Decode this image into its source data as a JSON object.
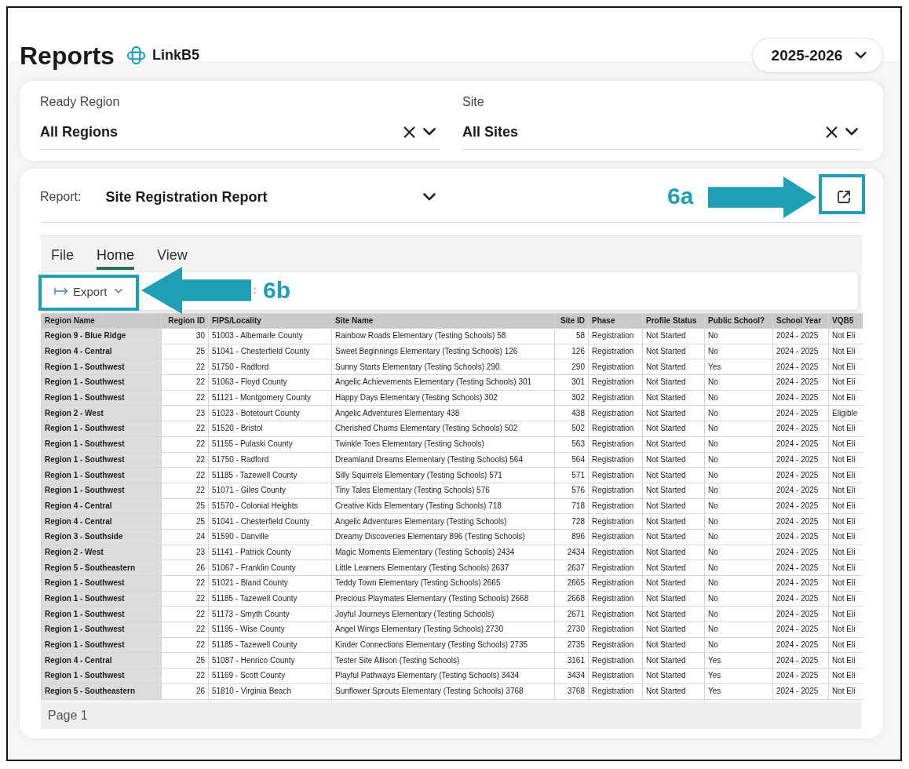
{
  "header": {
    "title": "Reports",
    "brand": "LinkB5",
    "year_select": {
      "value": "2025-2026"
    }
  },
  "filters": [
    {
      "label": "Ready Region",
      "value": "All Regions"
    },
    {
      "label": "Site",
      "value": "All Sites"
    }
  ],
  "report": {
    "label": "Report:",
    "value": "Site Registration Report",
    "annotation": {
      "label": "6a"
    }
  },
  "viewer": {
    "tabs": [
      {
        "label": "File",
        "selected": false
      },
      {
        "label": "Home",
        "selected": true
      },
      {
        "label": "View",
        "selected": false
      }
    ],
    "toolbar": {
      "export_button": {
        "label": "Export"
      },
      "annotation": {
        "label": "6b"
      }
    },
    "table": {
      "columns": [
        "Region Name",
        "Region ID",
        "FIPS/Locality",
        "Site Name",
        "Site ID",
        "Phase",
        "Profile Status",
        "Public School?",
        "School Year",
        "VQB5"
      ],
      "rows": [
        [
          "Region 9 - Blue Ridge",
          "30",
          "51003 - Albemarle County",
          "Rainbow Roads Elementary (Testing Schools) 58",
          "58",
          "Registration",
          "Not Started",
          "No",
          "2024 - 2025",
          "Not Eli"
        ],
        [
          "Region 4 - Central",
          "25",
          "51041 - Chesterfield County",
          "Sweet Beginnings Elementary (Testing Schools) 126",
          "126",
          "Registration",
          "Not Started",
          "No",
          "2024 - 2025",
          "Not Eli"
        ],
        [
          "Region 1 - Southwest",
          "22",
          "51750 - Radford",
          "Sunny Starts Elementary (Testing Schools) 290",
          "290",
          "Registration",
          "Not Started",
          "Yes",
          "2024 - 2025",
          "Not Eli"
        ],
        [
          "Region 1 - Southwest",
          "22",
          "51063 - Floyd County",
          "Angelic Achievements Elementary (Testing Schools) 301",
          "301",
          "Registration",
          "Not Started",
          "No",
          "2024 - 2025",
          "Not Eli"
        ],
        [
          "Region 1 - Southwest",
          "22",
          "51121 - Montgomery County",
          "Happy Days Elementary (Testing Schools) 302",
          "302",
          "Registration",
          "Not Started",
          "No",
          "2024 - 2025",
          "Not Eli"
        ],
        [
          "Region 2 - West",
          "23",
          "51023 - Botetourt County",
          "Angelic Adventures Elementary 438",
          "438",
          "Registration",
          "Not Started",
          "No",
          "2024 - 2025",
          "Eligible"
        ],
        [
          "Region 1 - Southwest",
          "22",
          "51520 - Bristol",
          "Cherished Chums Elementary (Testing Schools) 502",
          "502",
          "Registration",
          "Not Started",
          "No",
          "2024 - 2025",
          "Not Eli"
        ],
        [
          "Region 1 - Southwest",
          "22",
          "51155 - Pulaski County",
          "Twinkle Toes Elementary (Testing Schools)",
          "563",
          "Registration",
          "Not Started",
          "No",
          "2024 - 2025",
          "Not Eli"
        ],
        [
          "Region 1 - Southwest",
          "22",
          "51750 - Radford",
          "Dreamland Dreams Elementary (Testing Schools) 564",
          "564",
          "Registration",
          "Not Started",
          "No",
          "2024 - 2025",
          "Not Eli"
        ],
        [
          "Region 1 - Southwest",
          "22",
          "51185 - Tazewell County",
          "Silly Squirrels Elementary (Testing Schools) 571",
          "571",
          "Registration",
          "Not Started",
          "No",
          "2024 - 2025",
          "Not Eli"
        ],
        [
          "Region 1 - Southwest",
          "22",
          "51071 - Giles County",
          "Tiny Tales Elementary (Testing Schools) 576",
          "576",
          "Registration",
          "Not Started",
          "No",
          "2024 - 2025",
          "Not Eli"
        ],
        [
          "Region 4 - Central",
          "25",
          "51570 - Colonial Heights",
          "Creative Kids Elementary (Testing Schools) 718",
          "718",
          "Registration",
          "Not Started",
          "No",
          "2024 - 2025",
          "Not Eli"
        ],
        [
          "Region 4 - Central",
          "25",
          "51041 - Chesterfield County",
          "Angelic Adventures Elementary (Testing Schools)",
          "728",
          "Registration",
          "Not Started",
          "No",
          "2024 - 2025",
          "Not Eli"
        ],
        [
          "Region 3 - Southside",
          "24",
          "51590 - Danville",
          "Dreamy Discoveries Elementary 896 (Testing Schools)",
          "896",
          "Registration",
          "Not Started",
          "No",
          "2024 - 2025",
          "Not Eli"
        ],
        [
          "Region 2 - West",
          "23",
          "51141 - Patrick County",
          "Magic Moments Elementary (Testing Schools) 2434",
          "2434",
          "Registration",
          "Not Started",
          "No",
          "2024 - 2025",
          "Not Eli"
        ],
        [
          "Region 5 - Southeastern",
          "26",
          "51067 - Franklin County",
          "Little Learners Elementary (Testing Schools) 2637",
          "2637",
          "Registration",
          "Not Started",
          "No",
          "2024 - 2025",
          "Not Eli"
        ],
        [
          "Region 1 - Southwest",
          "22",
          "51021 - Bland County",
          "Teddy Town Elementary (Testing Schools) 2665",
          "2665",
          "Registration",
          "Not Started",
          "No",
          "2024 - 2025",
          "Not Eli"
        ],
        [
          "Region 1 - Southwest",
          "22",
          "51185 - Tazewell County",
          "Precious Playmates Elementary (Testing Schools) 2668",
          "2668",
          "Registration",
          "Not Started",
          "No",
          "2024 - 2025",
          "Not Eli"
        ],
        [
          "Region 1 - Southwest",
          "22",
          "51173 - Smyth County",
          "Joyful Journeys Elementary (Testing Schools)",
          "2671",
          "Registration",
          "Not Started",
          "No",
          "2024 - 2025",
          "Not Eli"
        ],
        [
          "Region 1 - Southwest",
          "22",
          "51195 - Wise County",
          "Angel Wings Elementary (Testing Schools) 2730",
          "2730",
          "Registration",
          "Not Started",
          "No",
          "2024 - 2025",
          "Not Eli"
        ],
        [
          "Region 1 - Southwest",
          "22",
          "51185 - Tazewell County",
          "Kinder Connections Elementary (Testing Schools) 2735",
          "2735",
          "Registration",
          "Not Started",
          "No",
          "2024 - 2025",
          "Not Eli"
        ],
        [
          "Region 4 - Central",
          "25",
          "51087 - Henrico County",
          "Tester Site Allison (Testing Schools)",
          "3161",
          "Registration",
          "Not Started",
          "Yes",
          "2024 - 2025",
          "Not Eli"
        ],
        [
          "Region 1 - Southwest",
          "22",
          "51169 - Scott County",
          "Playful Pathways Elementary (Testing Schools) 3434",
          "3434",
          "Registration",
          "Not Started",
          "Yes",
          "2024 - 2025",
          "Not Eli"
        ],
        [
          "Region 5 - Southeastern",
          "26",
          "51810 - Virginia Beach",
          "Sunflower Sprouts Elementary (Testing Schools) 3768",
          "3768",
          "Registration",
          "Not Started",
          "Yes",
          "2024 - 2025",
          "Not Eli"
        ]
      ]
    },
    "status_bar": {
      "page": "Page 1"
    }
  }
}
